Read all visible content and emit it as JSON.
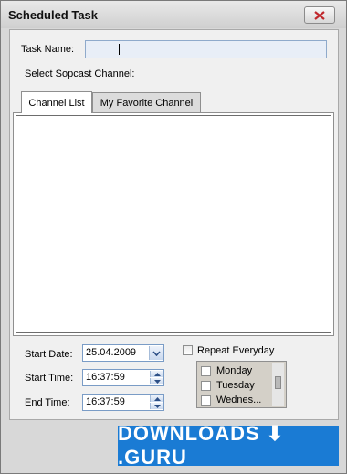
{
  "window": {
    "title": "Scheduled Task",
    "close_glyph": "x"
  },
  "form": {
    "task_name_label": "Task Name:",
    "task_name_value": "",
    "select_channel_label": "Select Sopcast Channel:"
  },
  "tabs": [
    {
      "label": "Channel List",
      "active": true
    },
    {
      "label": "My Favorite Channel",
      "active": false
    }
  ],
  "schedule": {
    "start_date_label": "Start Date:",
    "start_date_value": "25.04.2009",
    "start_time_label": "Start Time:",
    "start_time_value": "16:37:59",
    "end_time_label": "End Time:",
    "end_time_value": "16:37:59",
    "repeat_label": "Repeat Everyday",
    "repeat_checked": false,
    "days": [
      "Monday",
      "Tuesday",
      "Wednes..."
    ]
  },
  "watermark": {
    "text": "DOWNLOADS ⬇ .GURU"
  },
  "colors": {
    "accent": "#1a7bd4",
    "close_x": "#c0282d"
  }
}
